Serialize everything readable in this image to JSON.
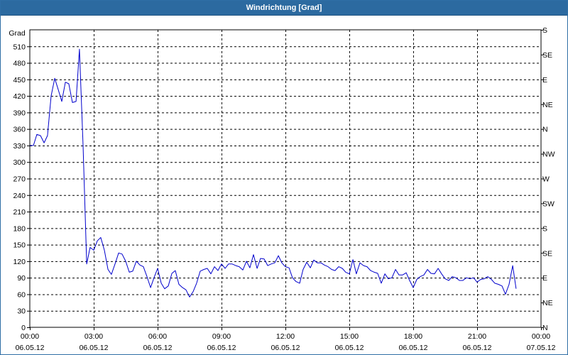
{
  "window": {
    "title": "Windrichtung [Grad]"
  },
  "chart_data": {
    "type": "line",
    "title": "Windrichtung [Grad]",
    "ylabel": "Grad",
    "ylim": [
      0,
      540
    ],
    "y_ticks": [
      0,
      30,
      60,
      90,
      120,
      150,
      180,
      210,
      240,
      270,
      300,
      330,
      360,
      390,
      420,
      450,
      480,
      510
    ],
    "right_axis": {
      "ticks": [
        0,
        45,
        90,
        135,
        180,
        225,
        270,
        315,
        360,
        405,
        450,
        495,
        540
      ],
      "labels": [
        "N",
        "NE",
        "E",
        "SE",
        "S",
        "SW",
        "W",
        "NW",
        "N",
        "NE",
        "E",
        "SE",
        "S"
      ]
    },
    "xlim": [
      0,
      24
    ],
    "x_ticks": [
      {
        "x": 0,
        "time": "00:00",
        "date": "06.05.12"
      },
      {
        "x": 3,
        "time": "03:00",
        "date": "06.05.12"
      },
      {
        "x": 6,
        "time": "06:00",
        "date": "06.05.12"
      },
      {
        "x": 9,
        "time": "09:00",
        "date": "06.05.12"
      },
      {
        "x": 12,
        "time": "12:00",
        "date": "06.05.12"
      },
      {
        "x": 15,
        "time": "15:00",
        "date": "06.05.12"
      },
      {
        "x": 18,
        "time": "18:00",
        "date": "06.05.12"
      },
      {
        "x": 21,
        "time": "21:00",
        "date": "06.05.12"
      },
      {
        "x": 24,
        "time": "00:00",
        "date": "07.05.12"
      }
    ],
    "grid": true,
    "colors": {
      "line": "#0000cc",
      "grid": "#000000",
      "title_bar": "#2c6aa0"
    },
    "series": [
      {
        "points": [
          [
            0.0,
            330
          ],
          [
            0.17,
            330
          ],
          [
            0.33,
            350
          ],
          [
            0.5,
            348
          ],
          [
            0.67,
            335
          ],
          [
            0.83,
            348
          ],
          [
            1.0,
            420
          ],
          [
            1.17,
            452
          ],
          [
            1.33,
            432
          ],
          [
            1.5,
            410
          ],
          [
            1.67,
            445
          ],
          [
            1.83,
            442
          ],
          [
            2.0,
            408
          ],
          [
            2.17,
            410
          ],
          [
            2.33,
            505
          ],
          [
            2.5,
            330
          ],
          [
            2.67,
            115
          ],
          [
            2.83,
            145
          ],
          [
            3.0,
            140
          ],
          [
            3.17,
            157
          ],
          [
            3.33,
            163
          ],
          [
            3.5,
            140
          ],
          [
            3.67,
            105
          ],
          [
            3.83,
            96
          ],
          [
            4.0,
            115
          ],
          [
            4.17,
            135
          ],
          [
            4.33,
            133
          ],
          [
            4.5,
            120
          ],
          [
            4.67,
            100
          ],
          [
            4.83,
            102
          ],
          [
            5.0,
            120
          ],
          [
            5.17,
            113
          ],
          [
            5.33,
            110
          ],
          [
            5.5,
            92
          ],
          [
            5.67,
            72
          ],
          [
            5.83,
            90
          ],
          [
            6.0,
            107
          ],
          [
            6.17,
            80
          ],
          [
            6.33,
            70
          ],
          [
            6.5,
            75
          ],
          [
            6.67,
            98
          ],
          [
            6.83,
            103
          ],
          [
            7.0,
            78
          ],
          [
            7.17,
            72
          ],
          [
            7.33,
            68
          ],
          [
            7.5,
            55
          ],
          [
            7.67,
            65
          ],
          [
            7.83,
            80
          ],
          [
            8.0,
            102
          ],
          [
            8.17,
            105
          ],
          [
            8.33,
            107
          ],
          [
            8.5,
            97
          ],
          [
            8.67,
            110
          ],
          [
            8.83,
            103
          ],
          [
            9.0,
            115
          ],
          [
            9.17,
            107
          ],
          [
            9.33,
            115
          ],
          [
            9.5,
            115
          ],
          [
            9.67,
            112
          ],
          [
            9.83,
            110
          ],
          [
            10.0,
            104
          ],
          [
            10.17,
            120
          ],
          [
            10.33,
            108
          ],
          [
            10.5,
            132
          ],
          [
            10.67,
            107
          ],
          [
            10.83,
            125
          ],
          [
            11.0,
            124
          ],
          [
            11.17,
            112
          ],
          [
            11.33,
            115
          ],
          [
            11.5,
            117
          ],
          [
            11.67,
            130
          ],
          [
            11.83,
            117
          ],
          [
            12.0,
            110
          ],
          [
            12.17,
            108
          ],
          [
            12.33,
            90
          ],
          [
            12.5,
            83
          ],
          [
            12.67,
            80
          ],
          [
            12.83,
            105
          ],
          [
            13.0,
            118
          ],
          [
            13.17,
            108
          ],
          [
            13.33,
            122
          ],
          [
            13.5,
            117
          ],
          [
            13.67,
            117
          ],
          [
            13.83,
            113
          ],
          [
            14.0,
            110
          ],
          [
            14.17,
            105
          ],
          [
            14.33,
            103
          ],
          [
            14.5,
            110
          ],
          [
            14.67,
            107
          ],
          [
            14.83,
            100
          ],
          [
            15.0,
            97
          ],
          [
            15.17,
            123
          ],
          [
            15.33,
            97
          ],
          [
            15.5,
            117
          ],
          [
            15.67,
            112
          ],
          [
            15.83,
            110
          ],
          [
            16.0,
            103
          ],
          [
            16.17,
            100
          ],
          [
            16.33,
            98
          ],
          [
            16.5,
            80
          ],
          [
            16.67,
            97
          ],
          [
            16.83,
            88
          ],
          [
            17.0,
            90
          ],
          [
            17.17,
            105
          ],
          [
            17.33,
            95
          ],
          [
            17.5,
            95
          ],
          [
            17.67,
            99
          ],
          [
            17.83,
            85
          ],
          [
            18.0,
            72
          ],
          [
            18.17,
            87
          ],
          [
            18.33,
            92
          ],
          [
            18.5,
            95
          ],
          [
            18.67,
            105
          ],
          [
            18.83,
            98
          ],
          [
            19.0,
            97
          ],
          [
            19.17,
            107
          ],
          [
            19.33,
            97
          ],
          [
            19.5,
            88
          ],
          [
            19.67,
            85
          ],
          [
            19.83,
            92
          ],
          [
            20.0,
            90
          ],
          [
            20.17,
            85
          ],
          [
            20.33,
            85
          ],
          [
            20.5,
            90
          ],
          [
            20.67,
            88
          ],
          [
            20.83,
            90
          ],
          [
            21.0,
            82
          ],
          [
            21.17,
            87
          ],
          [
            21.33,
            88
          ],
          [
            21.5,
            92
          ],
          [
            21.67,
            87
          ],
          [
            21.83,
            80
          ],
          [
            22.0,
            78
          ],
          [
            22.17,
            75
          ],
          [
            22.33,
            60
          ],
          [
            22.5,
            78
          ],
          [
            22.67,
            112
          ],
          [
            22.83,
            70
          ]
        ]
      }
    ]
  }
}
